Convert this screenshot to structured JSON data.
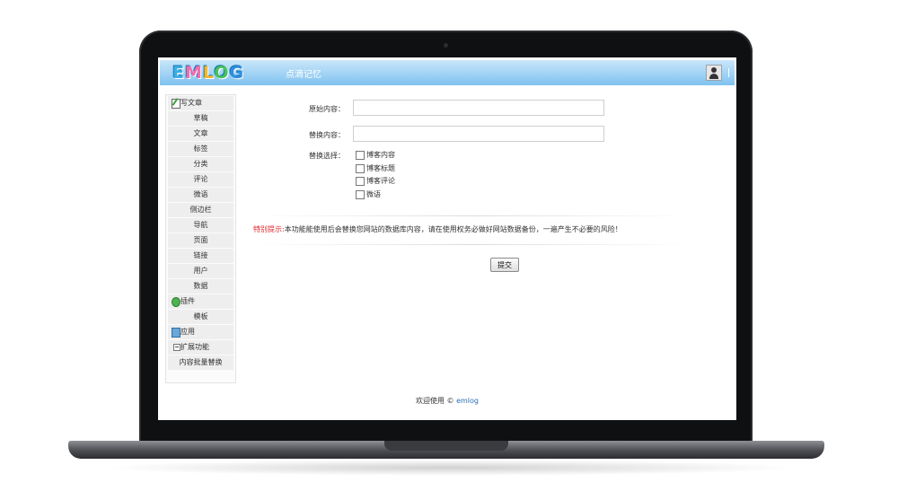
{
  "header": {
    "logo_letters": [
      "E",
      "M",
      "L",
      "O",
      "G"
    ],
    "site_title": "点滴记忆",
    "user_icon": "user-avatar-icon"
  },
  "sidebar": {
    "items": [
      {
        "label": "写文章",
        "icon": "write-icon"
      },
      {
        "label": "草稿"
      },
      {
        "label": "文章"
      },
      {
        "label": "标签"
      },
      {
        "label": "分类"
      },
      {
        "label": "评论"
      },
      {
        "label": "微语"
      },
      {
        "label": "侧边栏"
      },
      {
        "label": "导航"
      },
      {
        "label": "页面"
      },
      {
        "label": "链接"
      },
      {
        "label": "用户"
      },
      {
        "label": "数据"
      },
      {
        "label": "插件",
        "icon": "plugin-icon"
      },
      {
        "label": "模板"
      },
      {
        "label": "应用",
        "icon": "app-icon"
      },
      {
        "label": "扩展功能",
        "icon": "collapse-icon"
      },
      {
        "label": "内容批量替换"
      }
    ]
  },
  "form": {
    "original_label": "原始内容：",
    "original_value": "",
    "replace_label": "替换内容：",
    "replace_value": "",
    "select_label": "替换选择：",
    "options": [
      {
        "label": "博客内容",
        "checked": false
      },
      {
        "label": "博客标题",
        "checked": false
      },
      {
        "label": "博客评论",
        "checked": false
      },
      {
        "label": "微语",
        "checked": false
      }
    ],
    "notice_prefix": "特别提示:",
    "notice_text": "本功能能使用后会替换您网站的数据库内容，请在使用权务必做好网站数据备份，一遍产生不必要的风险！",
    "submit_label": "提交"
  },
  "footer": {
    "text": "欢迎使用 ©",
    "link": "emlog"
  },
  "colors": {
    "header_gradient_top": "#c9e6fa",
    "header_gradient_bottom": "#7fc2ef",
    "notice_red": "#e0262c",
    "link_blue": "#2a6fb5"
  }
}
